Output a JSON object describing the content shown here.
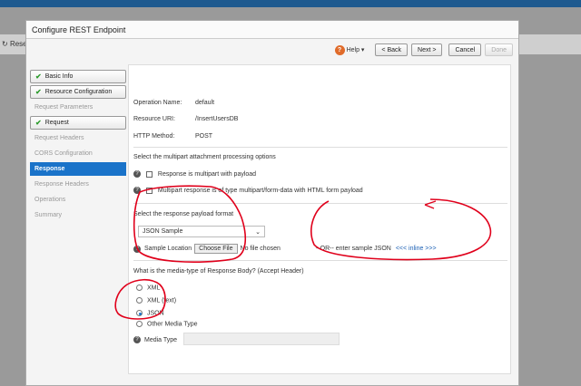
{
  "background": {
    "reset_label": "Reset"
  },
  "dialog": {
    "title": "Configure REST Endpoint",
    "toolbar": {
      "help": "Help ▾",
      "back": "< Back",
      "next": "Next >",
      "cancel": "Cancel",
      "done": "Done"
    }
  },
  "sidebar": {
    "items": [
      {
        "label": "Basic Info",
        "state": "done"
      },
      {
        "label": "Resource Configuration",
        "state": "done"
      },
      {
        "label": "Request Parameters",
        "state": "disabled"
      },
      {
        "label": "Request",
        "state": "done"
      },
      {
        "label": "Request Headers",
        "state": "disabled"
      },
      {
        "label": "CORS Configuration",
        "state": "disabled"
      },
      {
        "label": "Response",
        "state": "active"
      },
      {
        "label": "Response Headers",
        "state": "disabled"
      },
      {
        "label": "Operations",
        "state": "disabled"
      },
      {
        "label": "Summary",
        "state": "disabled"
      }
    ]
  },
  "info": {
    "operation_label": "Operation Name:",
    "operation_value": "default",
    "uri_label": "Resource URI:",
    "uri_value": "/InsertUsersDB",
    "method_label": "HTTP Method:",
    "method_value": "POST"
  },
  "multipart": {
    "heading": "Select the multipart attachment processing options",
    "option1": "Response is multipart with payload",
    "option2": "Multipart response is of type multipart/form-data with HTML form payload"
  },
  "payload": {
    "heading": "Select the response payload format",
    "format_value": "JSON Sample",
    "sample_location_label": "Sample Location",
    "choose_file": "Choose File",
    "no_file": "No file chosen",
    "or_text": "--OR-- enter sample JSON",
    "inline_link": "<<< inline >>>"
  },
  "media": {
    "heading": "What is the media-type of Response Body? (Accept Header)",
    "options": [
      "XML",
      "XML (text)",
      "JSON",
      "Other Media Type"
    ],
    "selected": "JSON",
    "media_type_label": "Media Type"
  },
  "colors": {
    "accent": "#1a73c9",
    "annotation": "#e0001b"
  }
}
